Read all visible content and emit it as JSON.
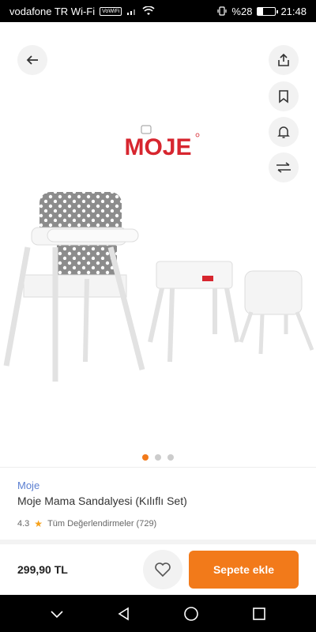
{
  "status_bar": {
    "carrier": "vodafone TR Wi-Fi",
    "vowifi_badge": "VoWiFi",
    "battery_percent": "%28",
    "time": "21:48",
    "battery_level": 0.28
  },
  "header": {
    "icons": [
      "back-arrow-icon",
      "share-icon",
      "bookmark-icon",
      "bell-icon",
      "compare-icon"
    ]
  },
  "gallery": {
    "brand_logo_text": "MOJE",
    "slide_count": 3,
    "active_slide": 1
  },
  "product": {
    "brand": "Moje",
    "title": "Moje Mama Sandalyesi (Kılıflı Set)",
    "rating": "4.3",
    "reviews_label": "Tüm Değerlendirmeler (729)"
  },
  "purchase": {
    "price": "299,90 TL",
    "add_to_cart_label": "Sepete ekle"
  },
  "colors": {
    "accent": "#f27a1a",
    "brand_link": "#5b7fd1",
    "logo_red": "#d7262f",
    "star": "#f6a11a"
  }
}
